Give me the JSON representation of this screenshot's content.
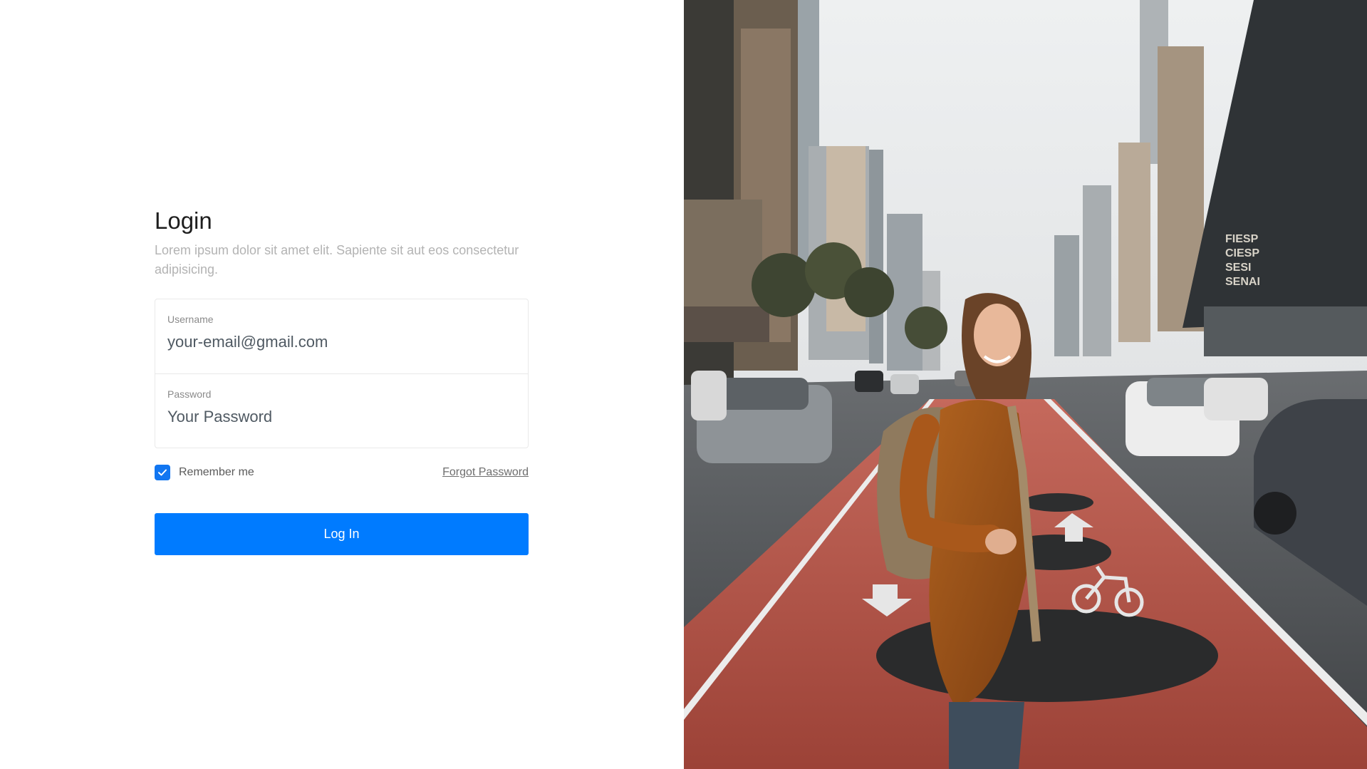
{
  "login": {
    "title": "Login",
    "subtitle": "Lorem ipsum dolor sit amet elit. Sapiente sit aut eos consectetur adipisicing.",
    "username": {
      "label": "Username",
      "value": "your-email@gmail.com"
    },
    "password": {
      "label": "Password",
      "placeholder": "Your Password"
    },
    "remember_me": {
      "label": "Remember me",
      "checked": true
    },
    "forgot_password": "Forgot Password",
    "submit_label": "Log In"
  },
  "hero": {
    "building_sign": [
      "FIESP",
      "CIESP",
      "SESI",
      "SENAI"
    ]
  },
  "colors": {
    "accent": "#007bff",
    "checkbox": "#1176f1",
    "muted_text": "#b3b3b3",
    "bike_lane": "#a8473c"
  }
}
